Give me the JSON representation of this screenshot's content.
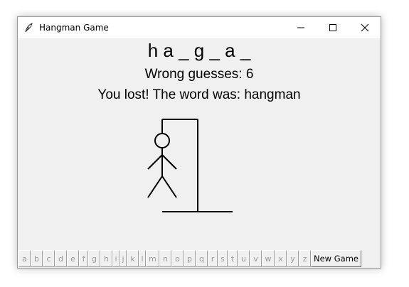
{
  "window": {
    "title": "Hangman Game",
    "app_icon": "feather-icon",
    "controls": [
      "minimize-icon",
      "maximize-icon",
      "close-icon"
    ]
  },
  "game": {
    "word_display": "h a _ g _ a _",
    "wrong_guesses_text": "Wrong guesses: 6",
    "status_text": "You lost! The word was: hangman",
    "wrong_guesses": 6
  },
  "keyboard": {
    "letters": [
      "a",
      "b",
      "c",
      "d",
      "e",
      "f",
      "g",
      "h",
      "i",
      "j",
      "k",
      "l",
      "m",
      "n",
      "o",
      "p",
      "q",
      "r",
      "s",
      "t",
      "u",
      "v",
      "w",
      "x",
      "y",
      "z"
    ],
    "new_game_label": "New Game",
    "letters_disabled": true
  }
}
